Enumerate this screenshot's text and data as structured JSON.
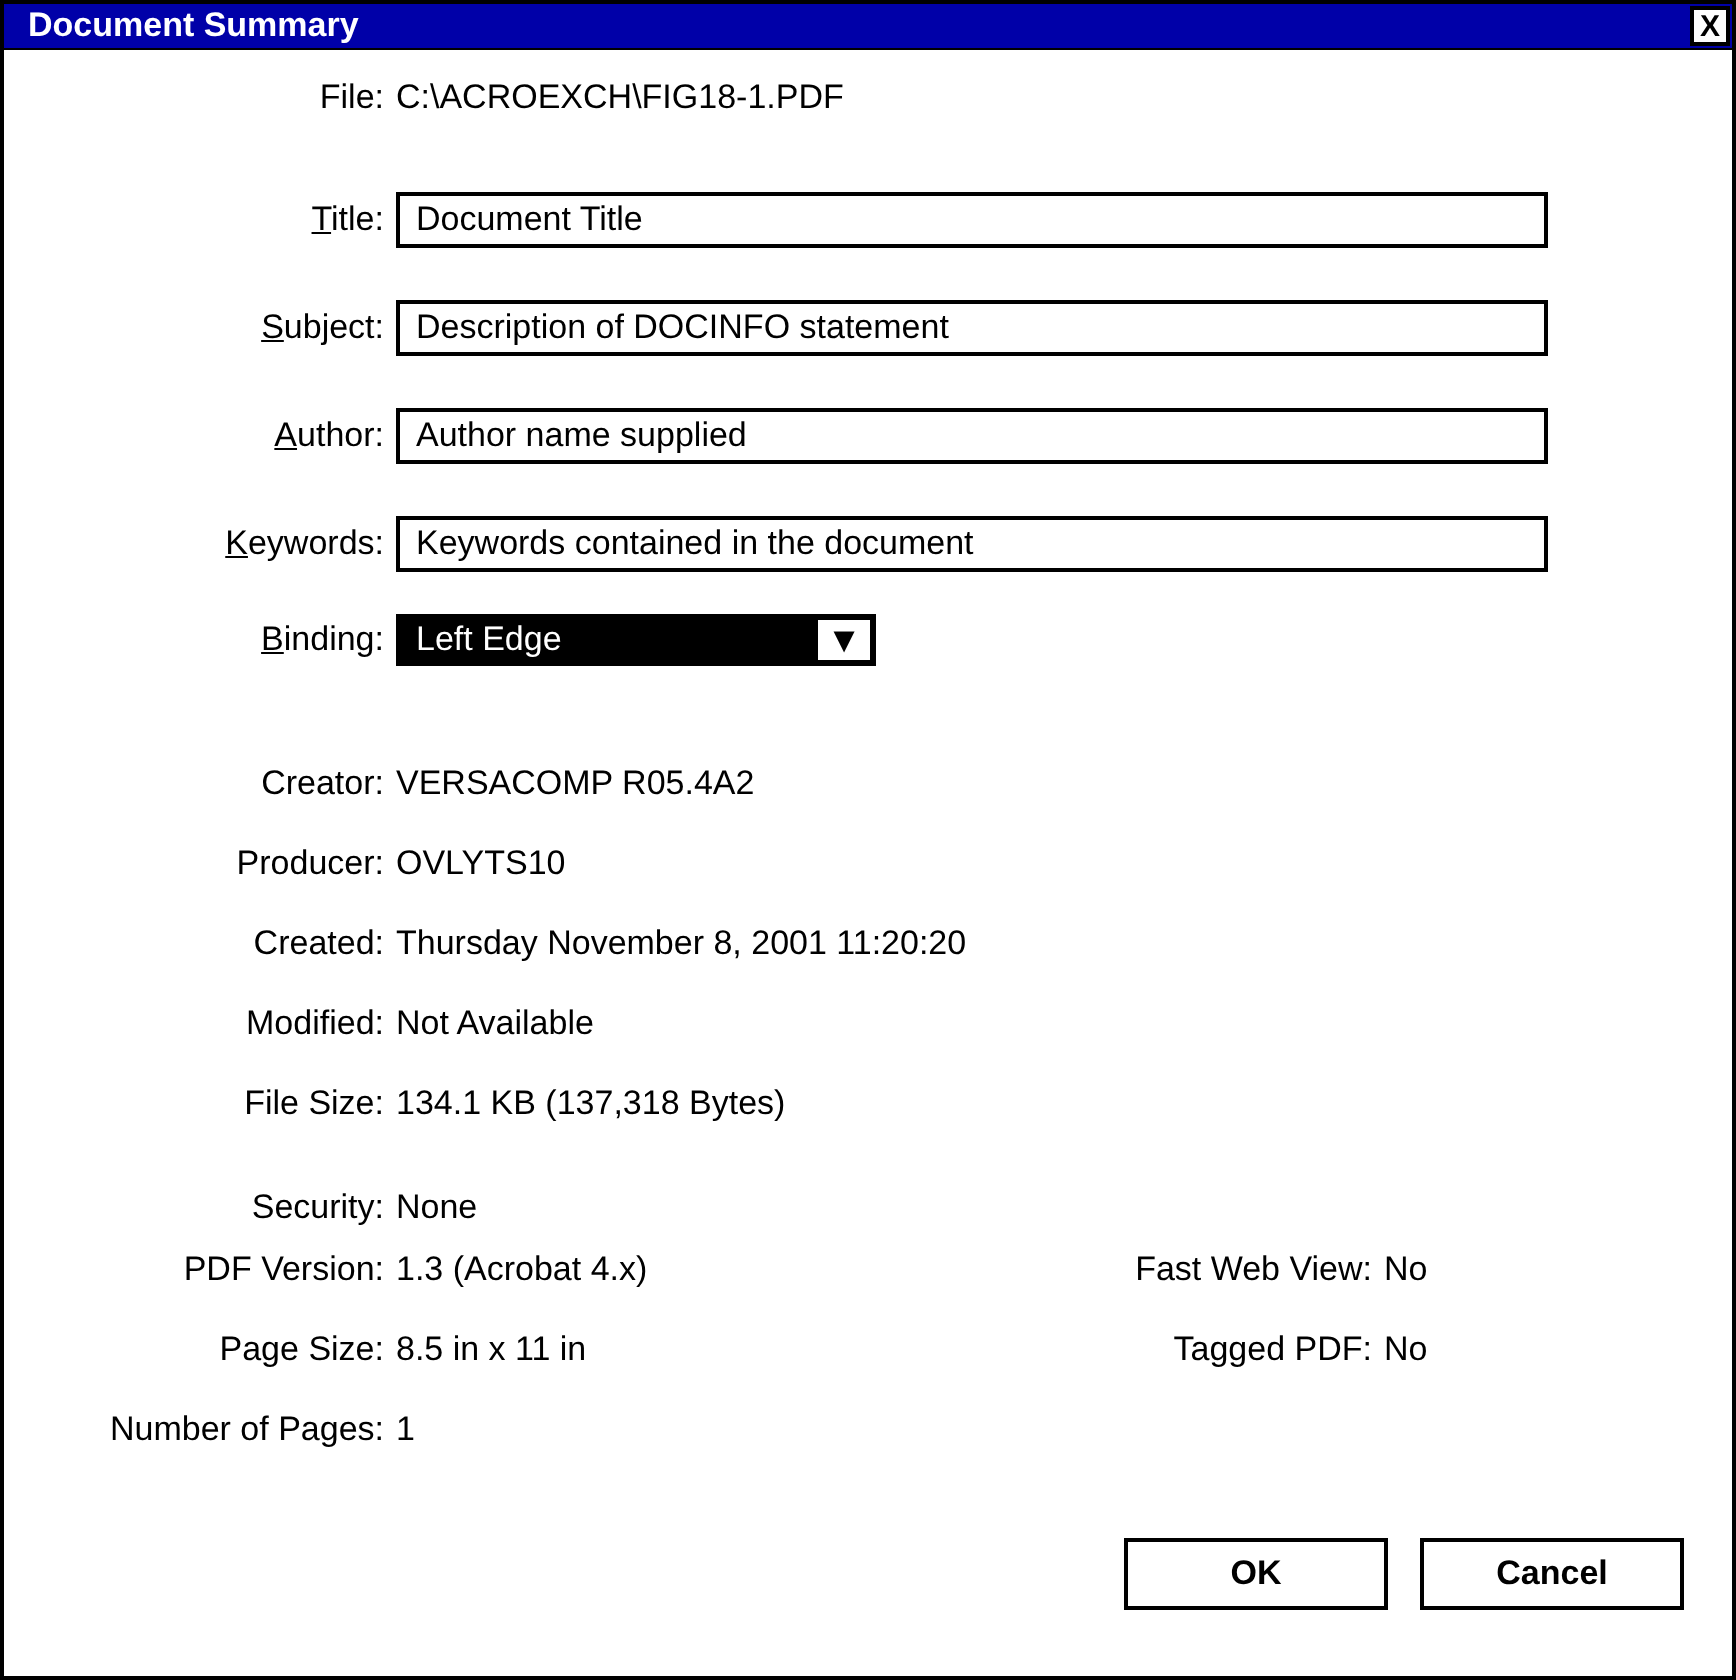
{
  "window": {
    "title": "Document Summary",
    "close": "X"
  },
  "file": {
    "label": "File:",
    "value": "C:\\ACROEXCH\\FIG18-1.PDF"
  },
  "fields": [
    {
      "label": "Title:",
      "underline_first": true,
      "value": "Document Title"
    },
    {
      "label": "Subject:",
      "underline_first": true,
      "value": "Description of DOCINFO statement"
    },
    {
      "label": "Author:",
      "underline_first": true,
      "value": "Author name supplied"
    },
    {
      "label": "Keywords:",
      "underline_first": true,
      "value": "Keywords contained in the document"
    }
  ],
  "binding": {
    "label": "Binding:",
    "underline_first": true,
    "value": "Left Edge",
    "arrow": "▼"
  },
  "info": [
    {
      "label": "Creator:",
      "value": "VERSACOMP R05.4A2"
    },
    {
      "label": "Producer:",
      "value": "OVLYTS10"
    },
    {
      "label": "Created:",
      "value": "Thursday November 8, 2001 11:20:20"
    },
    {
      "label": "Modified:",
      "value": "Not Available"
    },
    {
      "label": "File Size:",
      "value": "134.1 KB (137,318 Bytes)"
    },
    {
      "label": "Security:",
      "value": "None"
    }
  ],
  "details": [
    {
      "label": "PDF Version:",
      "value": "1.3 (Acrobat 4.x)",
      "side_label": "Fast Web View:",
      "side_value": "No"
    },
    {
      "label": "Page Size:",
      "value": "8.5 in x 11 in",
      "side_label": "Tagged PDF:",
      "side_value": "No"
    },
    {
      "label": "Number of Pages:",
      "value": "1"
    }
  ],
  "buttons": [
    "OK",
    "Cancel"
  ]
}
